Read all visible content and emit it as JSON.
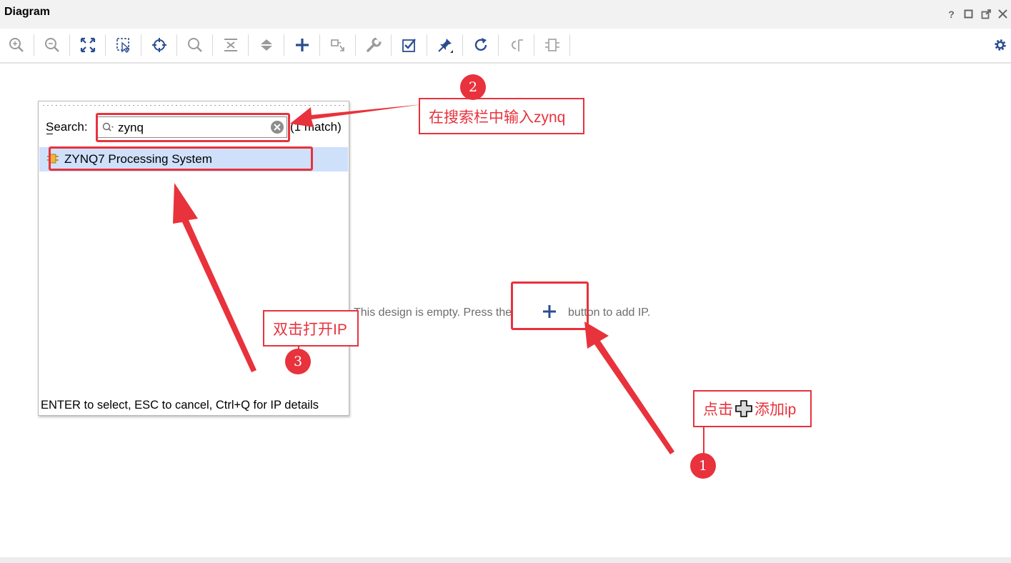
{
  "window": {
    "title": "Diagram"
  },
  "toolbar": {
    "tools": [
      {
        "name": "zoom-in-icon",
        "glyph": "⊕"
      },
      {
        "name": "zoom-out-icon",
        "glyph": "⊖"
      },
      {
        "name": "zoom-fit-icon",
        "glyph": "⤢"
      },
      {
        "name": "select-area-icon",
        "glyph": "⬚"
      },
      {
        "name": "auto-connect-icon",
        "glyph": "⊙"
      },
      {
        "name": "search-icon",
        "glyph": "🔍"
      },
      {
        "name": "collapse-icon",
        "glyph": "⏚"
      },
      {
        "name": "expand-icon",
        "glyph": "⇕"
      },
      {
        "name": "add-ip-icon",
        "glyph": "+"
      },
      {
        "name": "add-module-icon",
        "glyph": "⇲"
      },
      {
        "name": "properties-icon",
        "glyph": "🔧"
      },
      {
        "name": "validate-icon",
        "glyph": "☑"
      },
      {
        "name": "pin-icon",
        "glyph": "📌"
      },
      {
        "name": "refresh-icon",
        "glyph": "↻"
      },
      {
        "name": "regenerate-icon",
        "glyph": "⟲"
      },
      {
        "name": "port-icon",
        "glyph": "⊏"
      }
    ]
  },
  "canvas": {
    "empty_before": "This design is empty. Press the",
    "empty_after": "button to add IP."
  },
  "popup": {
    "search_label": "Search:",
    "search_value": "zynq",
    "match_text": "(1 match)",
    "result": "ZYNQ7 Processing System",
    "footer": "ENTER to select, ESC to cancel, Ctrl+Q for IP details"
  },
  "annotations": {
    "step1": {
      "number": "1",
      "text_before": "点击",
      "text_after": "添加ip"
    },
    "step2": {
      "number": "2",
      "text": "在搜索栏中输入zynq"
    },
    "step3": {
      "number": "3",
      "text": "双击打开IP"
    }
  },
  "colors": {
    "annotation_red": "#e8323c",
    "selection_blue": "#cfe0fb",
    "accent_blue": "#2a4d8f"
  }
}
